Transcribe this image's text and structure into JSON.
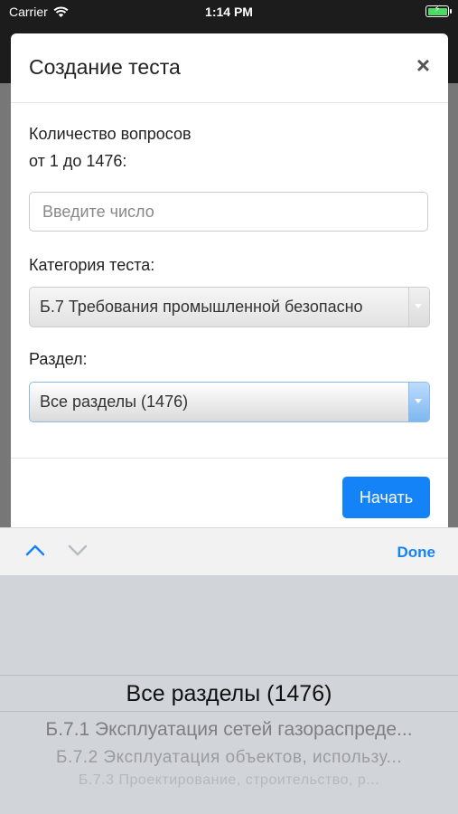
{
  "status_bar": {
    "carrier": "Carrier",
    "time": "1:14 PM"
  },
  "modal": {
    "title": "Создание теста",
    "close_glyph": "×",
    "questions_label_line1": "Количество вопросов",
    "questions_label_line2": "от 1 до 1476:",
    "questions_input": {
      "value": "",
      "placeholder": "Введите число"
    },
    "category_label": "Категория теста:",
    "category_value": "Б.7 Требования промышленной безопасно",
    "section_label": "Раздел:",
    "section_value": "Все разделы (1476)",
    "start_button": "Начать"
  },
  "toolbar": {
    "done": "Done",
    "up_icon": "chevron-up-icon",
    "down_icon": "chevron-down-icon"
  },
  "picker": {
    "items": [
      "Все разделы (1476)",
      "Б.7.1 Эксплуатация сетей газораспреде...",
      "Б.7.2 Эксплуатация объектов, использу...",
      "Б.7.3 Проектирование, строительство, р...",
      ""
    ]
  },
  "colors": {
    "accent": "#1583f8",
    "battery": "#4cd964"
  }
}
